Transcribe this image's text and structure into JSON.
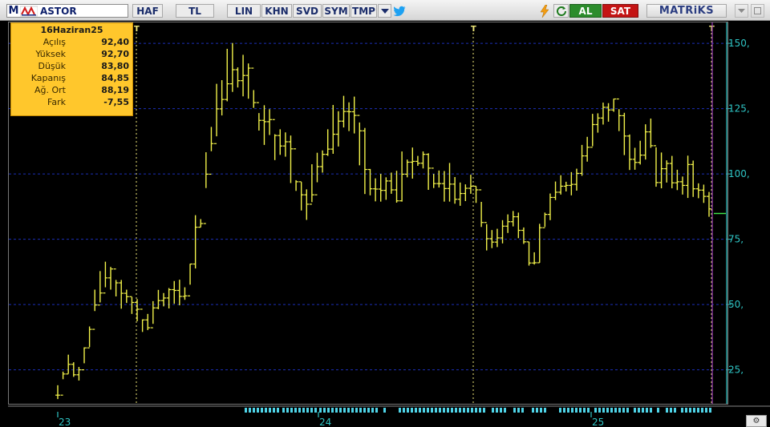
{
  "toolbar": {
    "symbol_prefix": "M",
    "symbol": "ASTOR",
    "buttons": [
      "HAF",
      "TL",
      "LIN",
      "KHN",
      "SVD",
      "SYM",
      "TMP"
    ],
    "al_label": "AL",
    "sat_label": "SAT",
    "brand": "MATRiKS",
    "icons": [
      "dropdown-arrow-icon",
      "twitter-bird-icon",
      "lightning-icon",
      "refresh-icon",
      "window-minimize-icon",
      "window-maximize-icon"
    ]
  },
  "info": {
    "date": "16Haziran25",
    "rows": [
      {
        "label": "Açılış",
        "value": "92,40"
      },
      {
        "label": "Yüksek",
        "value": "92,70"
      },
      {
        "label": "Düşük",
        "value": "83,80"
      },
      {
        "label": "Kapanış",
        "value": "84,85"
      },
      {
        "label": "Ağ. Ort",
        "value": "88,19"
      },
      {
        "label": "Fark",
        "value": "-7,55"
      }
    ]
  },
  "colors": {
    "price_bars": "#f2f24a",
    "grid": "#1d2fb8",
    "axis": "#2ec4c4",
    "year_marker": "#f0e87a",
    "cursor": "#9a3ab8"
  },
  "chart_data": {
    "type": "ohlc",
    "ylim": [
      12,
      158
    ],
    "yticks": [
      25,
      50,
      75,
      100,
      125,
      150
    ],
    "ytick_labels": [
      "25,",
      "50,",
      "75,",
      "100,",
      "125,",
      "150,"
    ],
    "year_labels": [
      "23",
      "24",
      "25"
    ],
    "year_marker_glyph": "T",
    "last_close_marker": 84.85,
    "volume_strip": true,
    "closes": [
      15.3,
      23.4,
      27.1,
      23.1,
      25.0,
      33.4,
      40.5,
      49.8,
      54.4,
      60.2,
      63.6,
      58.3,
      54.3,
      53.0,
      50.8,
      48.2,
      44.1,
      41.1,
      48.7,
      51.5,
      52.5,
      55.7,
      55.4,
      53.1,
      53.3,
      65.5,
      79.6,
      81.0,
      99.9,
      111.6,
      124.9,
      128.5,
      134.5,
      139.9,
      135.7,
      137.7,
      140.5,
      127.3,
      120.5,
      120.0,
      120.8,
      114.7,
      110.7,
      112.3,
      109.6,
      97.0,
      92.0,
      88.4,
      92.0,
      102.8,
      107.5,
      109.5,
      115.2,
      120.2,
      123.9,
      123.8,
      122.4,
      116.5,
      101.7,
      94.3,
      94.2,
      93.7,
      97.3,
      93.9,
      89.7,
      99.9,
      104.5,
      104.8,
      104.1,
      107.5,
      102.2,
      96.3,
      96.3,
      94.4,
      96.1,
      90.3,
      92.5,
      94.5,
      95.3,
      93.9,
      81.4,
      75.2,
      73.9,
      75.5,
      80.0,
      81.7,
      83.6,
      78.4,
      74.0,
      65.9,
      66.0,
      79.4,
      84.5,
      91.0,
      93.0,
      95.3,
      95.6,
      96.0,
      100.2,
      106.9,
      110.2,
      118.9,
      121.4,
      125.5,
      124.5,
      128.7,
      122.3,
      114.5,
      105.6,
      104.4,
      107.2,
      116.1,
      110.8,
      96.7,
      102.0,
      104.0,
      96.6,
      97.0,
      95.6,
      103.6,
      94.3,
      93.8,
      91.4,
      86.6
    ],
    "highs": [
      19.1,
      24.3,
      30.8,
      27.9,
      26.1,
      33.6,
      41.6,
      55.7,
      62.8,
      66.4,
      64.4,
      59.4,
      59.4,
      55.7,
      52.9,
      52.1,
      44.3,
      46.4,
      51.3,
      55.6,
      54.4,
      56.3,
      59.0,
      59.5,
      56.6,
      65.6,
      84.2,
      82.7,
      108.3,
      118.0,
      134.5,
      135.9,
      147.9,
      150.1,
      140.8,
      145.6,
      142.3,
      132.1,
      123.3,
      126.3,
      124.8,
      115.2,
      117.1,
      115.9,
      114.7,
      97.6,
      96.9,
      94.1,
      103.7,
      108.1,
      109.0,
      117.1,
      126.4,
      124.0,
      129.9,
      127.4,
      129.6,
      119.7,
      117.6,
      101.9,
      98.3,
      100.0,
      98.7,
      100.5,
      101.2,
      108.6,
      105.5,
      110.1,
      106.9,
      108.6,
      107.9,
      100.0,
      101.3,
      101.1,
      104.2,
      98.8,
      96.7,
      96.0,
      99.7,
      95.3,
      89.3,
      80.8,
      78.5,
      79.0,
      82.3,
      84.5,
      85.8,
      85.2,
      79.5,
      74.0,
      70.0,
      80.9,
      85.2,
      92.5,
      97.1,
      99.5,
      97.0,
      100.7,
      102.0,
      111.1,
      114.2,
      123.0,
      123.2,
      127.3,
      127.1,
      128.8,
      124.8,
      123.4,
      115.1,
      110.0,
      112.7,
      119.0,
      121.2,
      110.2,
      108.2,
      105.2,
      106.9,
      101.6,
      99.0,
      107.0,
      105.1,
      96.4,
      95.9,
      93.1
    ],
    "lows": [
      13.8,
      21.4,
      23.5,
      22.3,
      20.9,
      27.5,
      33.7,
      47.5,
      50.8,
      56.6,
      55.7,
      53.1,
      48.4,
      50.6,
      46.4,
      43.6,
      39.5,
      40.2,
      42.6,
      48.2,
      49.3,
      48.5,
      50.3,
      49.7,
      51.8,
      57.6,
      63.8,
      79.6,
      94.6,
      108.7,
      114.4,
      122.4,
      127.8,
      131.4,
      133.1,
      129.7,
      128.8,
      125.3,
      116.6,
      111.1,
      114.9,
      105.3,
      107.3,
      106.6,
      96.5,
      93.5,
      86.0,
      82.4,
      89.2,
      96.8,
      100.5,
      106.9,
      107.7,
      110.5,
      117.8,
      116.4,
      115.5,
      103.3,
      92.3,
      91.8,
      89.5,
      89.4,
      90.1,
      92.4,
      89.0,
      89.4,
      98.7,
      98.2,
      103.1,
      102.1,
      93.9,
      94.6,
      94.8,
      89.4,
      89.4,
      88.6,
      87.8,
      89.6,
      92.4,
      88.9,
      79.7,
      70.7,
      71.6,
      72.0,
      73.4,
      77.4,
      79.9,
      75.4,
      73.2,
      64.9,
      65.3,
      66.0,
      79.7,
      82.3,
      90.0,
      92.1,
      93.3,
      91.8,
      93.6,
      99.3,
      104.7,
      110.6,
      115.8,
      118.9,
      120.0,
      123.8,
      116.4,
      107.2,
      101.5,
      101.6,
      103.6,
      105.5,
      110.0,
      95.1,
      94.5,
      96.7,
      94.5,
      93.8,
      92.1,
      90.8,
      91.2,
      90.7,
      88.9,
      83.6
    ]
  }
}
